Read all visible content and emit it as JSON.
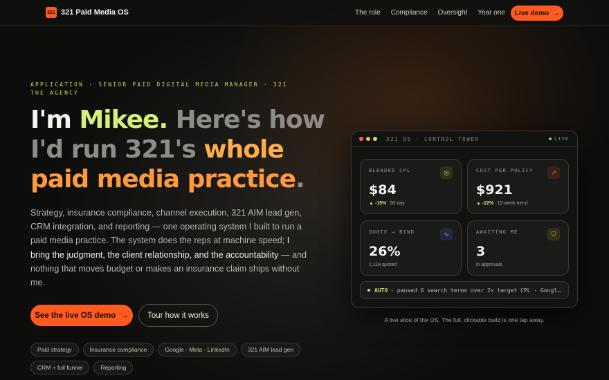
{
  "nav": {
    "logo_mark": "321",
    "logo_text": "321 Paid Media OS",
    "links": [
      "The role",
      "Compliance",
      "Oversight",
      "Year one"
    ],
    "cta_label": "Live demo",
    "cta_icon": "arrow-right-icon"
  },
  "hero": {
    "eyebrow": "APPLICATION · SENIOR PAID DIGITAL MEDIA MANAGER · 321 THE AGENCY",
    "headline": {
      "l1a": "I'm ",
      "l1b": "Mikee.",
      "l1c": " Here's how",
      "l2a": "I'd run 321's ",
      "l2b": "whole",
      "l3a": "paid media practice",
      "l3b": "."
    },
    "body_plain_1": "Strategy, insurance compliance, channel execution, 321 AIM lead gen, CRM integration, and reporting — one operating system I built to run a paid media practice. The system does the reps at machine speed; ",
    "body_strong": "I bring the judgment, the client relationship, and the accountability",
    "body_plain_2": " — and nothing that moves budget or makes an insurance claim ships without me.",
    "cta_primary": "See the live OS demo",
    "cta_secondary": "Tour how it works",
    "tags": [
      "Paid strategy",
      "Insurance compliance",
      "Google · Meta · LinkedIn",
      "321 AIM lead gen",
      "CRM + full funnel",
      "Reporting"
    ]
  },
  "panel": {
    "title": "321 OS · CONTROL TOWER",
    "live": "LIVE",
    "cards": [
      {
        "label": "BLENDED CPL",
        "value": "$84",
        "delta": "▲ -19%",
        "note": "30-day",
        "icon": "target-icon",
        "icon_color": "#c8e070",
        "icon_bg": "#2c3119"
      },
      {
        "label": "COST PER POLICY",
        "value": "$921",
        "delta": "▲ -22%",
        "note": "12-week trend",
        "icon": "trend-up-icon",
        "icon_color": "#ff7a3c",
        "icon_bg": "#3a2218"
      },
      {
        "label": "QUOTE → BIND",
        "value": "26%",
        "delta": "",
        "note": "1,118 quoted",
        "icon": "pulse-icon",
        "icon_color": "#9aa6ff",
        "icon_bg": "#25263a"
      },
      {
        "label": "AWAITING ME",
        "value": "3",
        "delta": "",
        "note": "in approvals",
        "icon": "shield-icon",
        "icon_color": "#f0c040",
        "icon_bg": "#33301a"
      }
    ],
    "ticker": {
      "tag": "AUTO",
      "text": "· paused 6 search terms over 2× target CPL · Google..."
    }
  },
  "caption": "A live slice of the OS. The full, clickable build is one tap away.",
  "colors": {
    "accent": "#ff5a1f",
    "lime": "#d8ee7a",
    "orange": "#ffad4a"
  }
}
